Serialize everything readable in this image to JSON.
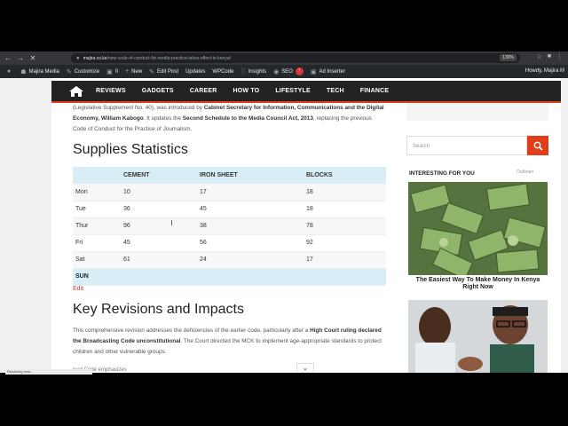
{
  "browser": {
    "url_domain": "majira.co.ke",
    "url_path": "/new-code-of-conduct-for-media-practice-takes-effect-in-kenya/",
    "zoom": "130%"
  },
  "adminbar": {
    "site_name": "Majira Media",
    "customize": "Customize",
    "comments": "0",
    "new": "New",
    "edit_post": "Edit Post",
    "updates": "Updates",
    "wpcode": "WPCode",
    "insights": "Insights",
    "seo": "SEO",
    "seo_count": "!",
    "ad_inserter": "Ad Inserter",
    "howdy": "Howdy, Majira M"
  },
  "sitenav": {
    "items": [
      "REVIEWS",
      "GADGETS",
      "CAREER",
      "HOW TO",
      "LIFESTYLE",
      "TECH",
      "FINANCE"
    ]
  },
  "article": {
    "intro_pre": "(Legislative Supplement No. 40), was introduced by ",
    "intro_bold1": "Cabinet Secretary for Information, Communications and the Digital Economy, William Kabogo",
    "intro_mid": ". It updates the ",
    "intro_bold2": "Second Schedule to the Media Council Act, 2013",
    "intro_post": ", replacing the previous Code of Conduct for the Practice of Journalism.",
    "heading1": "Supplies Statistics",
    "table": {
      "headers": [
        "",
        "CEMENT",
        "IRON SHEET",
        "BLOCKS"
      ],
      "rows": [
        [
          "Mon",
          "10",
          "17",
          "18"
        ],
        [
          "Tue",
          "36",
          "45",
          "18"
        ],
        [
          "Thur",
          "96",
          "38",
          "78"
        ],
        [
          "Fri",
          "45",
          "56",
          "92"
        ],
        [
          "Sat",
          "61",
          "24",
          "17"
        ],
        [
          "SUN",
          "",
          "",
          ""
        ]
      ]
    },
    "edit": "Edit",
    "heading2": "Key Revisions and Impacts",
    "p2_pre": "This comprehensive revision addresses the deficiencies of the earlier code, particularly after a ",
    "p2_bold": "High Court ruling declared the Broadcasting Code unconstitutional",
    "p2_post": ". The Court directed the MCK to implement age-appropriate standards to protect children and other vulnerable groups.",
    "partial": "ised Code emphasizes"
  },
  "sidebar": {
    "search_placeholder": "Search",
    "interest_title": "INTERESTING FOR YOU",
    "outbrain": "Outbrain",
    "ad1_caption": "The Easiest Way To Make Money In Kenya Right Now"
  },
  "status": "Resolving host..."
}
